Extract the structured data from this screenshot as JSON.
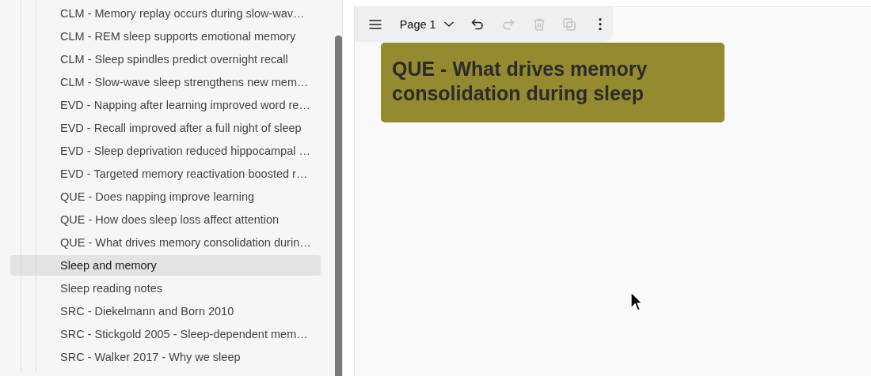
{
  "sidebar": {
    "items": [
      {
        "label": "CLM - Memory replay occurs during slow-wav…",
        "selected": false
      },
      {
        "label": "CLM - REM sleep supports emotional memory",
        "selected": false
      },
      {
        "label": "CLM - Sleep spindles predict overnight recall",
        "selected": false
      },
      {
        "label": "CLM - Slow-wave sleep strengthens new mem…",
        "selected": false
      },
      {
        "label": "EVD - Napping after learning improved word re…",
        "selected": false
      },
      {
        "label": "EVD - Recall improved after a full night of sleep",
        "selected": false
      },
      {
        "label": "EVD - Sleep deprivation reduced hippocampal …",
        "selected": false
      },
      {
        "label": "EVD - Targeted memory reactivation boosted r…",
        "selected": false
      },
      {
        "label": "QUE - Does napping improve learning",
        "selected": false
      },
      {
        "label": "QUE - How does sleep loss affect attention",
        "selected": false
      },
      {
        "label": "QUE - What drives memory consolidation durin…",
        "selected": false
      },
      {
        "label": "Sleep and memory",
        "selected": true
      },
      {
        "label": "Sleep reading notes",
        "selected": false
      },
      {
        "label": "SRC - Diekelmann and Born 2010",
        "selected": false
      },
      {
        "label": "SRC - Stickgold 2005 - Sleep-dependent mem…",
        "selected": false
      },
      {
        "label": "SRC - Walker 2017 - Why we sleep",
        "selected": false
      }
    ]
  },
  "toolbar": {
    "page_selector": {
      "label": "Page 1"
    },
    "buttons": [
      {
        "kind": "menu",
        "disabled": false
      },
      {
        "kind": "page"
      },
      {
        "kind": "undo",
        "disabled": false
      },
      {
        "kind": "redo",
        "disabled": true
      },
      {
        "kind": "delete",
        "disabled": true
      },
      {
        "kind": "duplicate",
        "disabled": true
      },
      {
        "kind": "more",
        "disabled": false
      }
    ]
  },
  "canvas": {
    "card": {
      "title": "QUE - What drives memory consolidation during sleep",
      "color": "#958a30"
    }
  }
}
